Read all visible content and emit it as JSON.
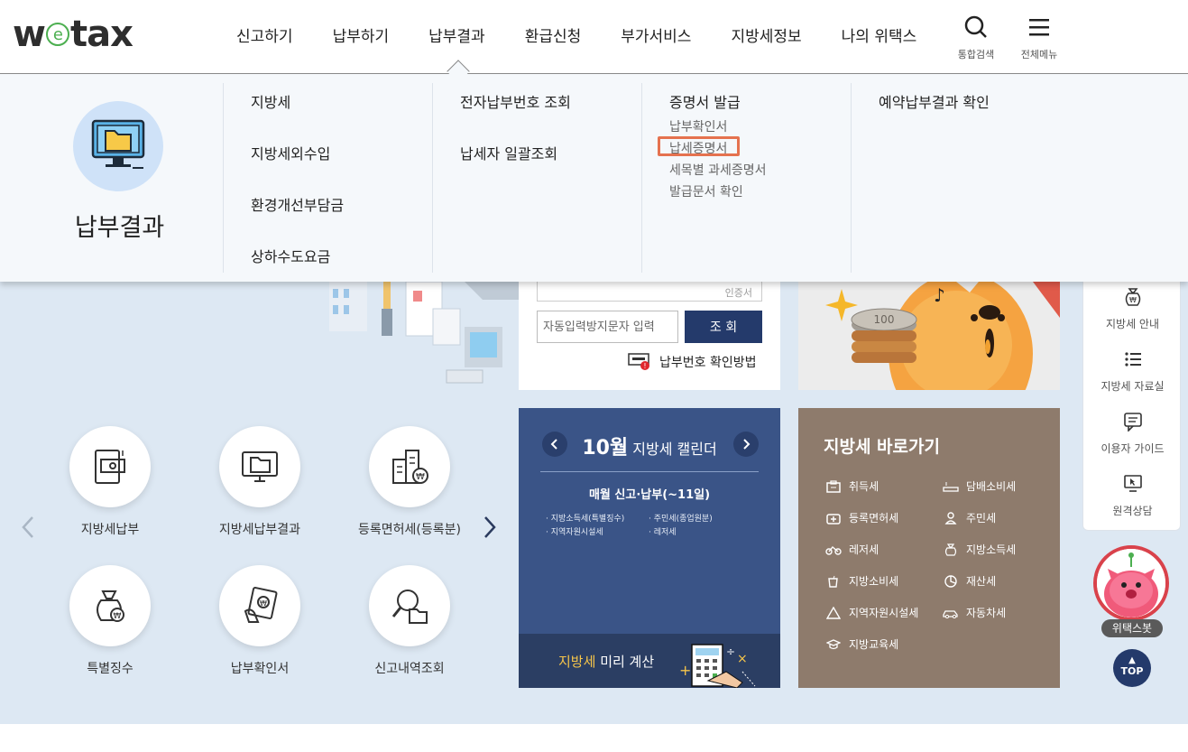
{
  "logo": {
    "prefix": "w",
    "e": "e",
    "suffix": "tax"
  },
  "gnb": [
    "신고하기",
    "납부하기",
    "납부결과",
    "환급신청",
    "부가서비스",
    "지방세정보",
    "나의 위택스"
  ],
  "header_buttons": {
    "search": "통합검색",
    "menu": "전체메뉴"
  },
  "mega": {
    "title": "납부결과",
    "col1": [
      "지방세",
      "지방세외수입",
      "환경개선부담금",
      "상하수도요금"
    ],
    "col2": [
      "전자납부번호 조회",
      "납세자 일괄조회"
    ],
    "col3": {
      "heading": "증명서 발급",
      "subs": [
        "납부확인서",
        "납세증명서",
        "세목별 과세증명서",
        "발급문서 확인"
      ]
    },
    "col4": [
      "예약납부결과 확인"
    ],
    "highlighted_item": "납세증명서"
  },
  "lookup": {
    "partial_cert_label": "인증서",
    "captcha_placeholder": "자동입력방지문자 입력",
    "button": "조 회",
    "howto": "납부번호 확인방법"
  },
  "quick_icons": [
    {
      "label": "지방세납부",
      "icon": "bill-icon"
    },
    {
      "label": "지방세납부결과",
      "icon": "monitor-folder-icon"
    },
    {
      "label": "등록면허세(등록분)",
      "icon": "building-won-icon"
    },
    {
      "label": "특별징수",
      "icon": "money-bag-icon"
    },
    {
      "label": "납부확인서",
      "icon": "receipt-won-icon"
    },
    {
      "label": "신고내역조회",
      "icon": "search-folder-icon"
    }
  ],
  "calendar": {
    "month": "10월",
    "title": "지방세 캘린더",
    "subtitle": "매월 신고·납부(~11일)",
    "items": [
      "지방소득세(특별징수)",
      "주민세(종업원분)",
      "지역자원시설세",
      "레저세"
    ],
    "calc_accent": "지방세",
    "calc_text": "미리 계산"
  },
  "shortcuts": {
    "title": "지방세 바로가기",
    "items": [
      "취득세",
      "담배소비세",
      "등록면허세",
      "주민세",
      "레저세",
      "지방소득세",
      "지방소비세",
      "재산세",
      "지역자원시설세",
      "자동차세",
      "지방교육세"
    ]
  },
  "quick_menu": [
    "지방세 안내",
    "지방세 자료실",
    "이용자 가이드",
    "원격상담"
  ],
  "chatbot_label": "위택스봇",
  "top_label": "TOP",
  "colors": {
    "navy": "#243a6b",
    "calendar_bg": "#3a5487",
    "shortcut_bg": "#8e7b6c",
    "highlight": "#e5724f",
    "bg": "#dde8f3"
  }
}
